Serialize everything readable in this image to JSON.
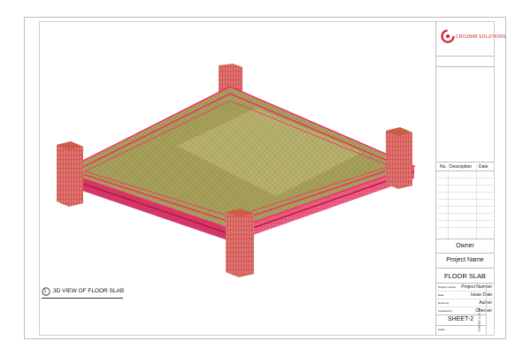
{
  "logo": {
    "brand": "CROZBIM SOLUTIONS",
    "color": "#d01f2a"
  },
  "revisions": {
    "col_no": "No.",
    "col_description": "Description",
    "col_date": "Date"
  },
  "titleblock": {
    "owner": "Owner",
    "project_name": "Project Name",
    "sheet_title": "FLOOR SLAB",
    "project_number_label": "Project number",
    "project_number_value": "Project Number",
    "date_label": "Date",
    "date_value": "Issue Date",
    "drawn_by_label": "Drawn by",
    "drawn_by_value": "Author",
    "checked_by_label": "Checked by",
    "checked_by_value": "Checker",
    "sheet_number": "SHEET-2",
    "scale_label": "Scale",
    "print_stamp": "1/24/2021 11:15 PM"
  },
  "view": {
    "number": "1",
    "title": "3D VIEW OF FLOOR SLAB"
  },
  "colors": {
    "slab": "#a7a05a",
    "slab_light": "#c6bf80",
    "rebar": "#ff1f6e",
    "rebar_dark": "#c2184f",
    "column": "#d97a6a"
  }
}
